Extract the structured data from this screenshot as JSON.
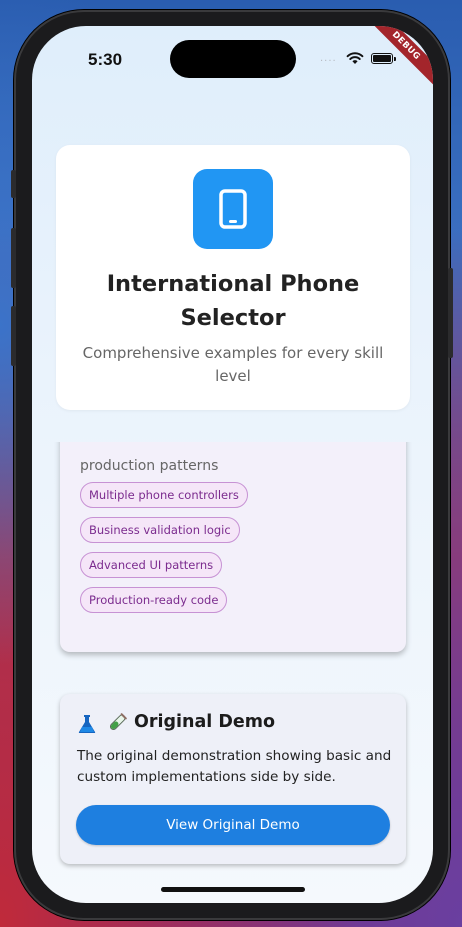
{
  "status_bar": {
    "time": "5:30",
    "signal": "....",
    "debug_label": "DEBUG"
  },
  "header": {
    "icon": "smartphone-icon",
    "title": "International Phone Selector",
    "subtitle": "Comprehensive examples for every skill level"
  },
  "advanced_card": {
    "description_fragment": "production patterns",
    "chips": [
      "Multiple phone controllers",
      "Business validation logic",
      "Advanced UI patterns",
      "Production-ready code"
    ]
  },
  "original_demo": {
    "icons": [
      "flask-icon",
      "test-tube-icon"
    ],
    "title": "Original Demo",
    "description": "The original demonstration showing basic and custom implementations side by side.",
    "button_label": "View Original Demo"
  },
  "colors": {
    "primary": "#2196f3",
    "button": "#1e7fe0",
    "chip_text": "#7b2b8e",
    "chip_border": "#c792d4",
    "debug_ribbon": "#a3252b"
  }
}
